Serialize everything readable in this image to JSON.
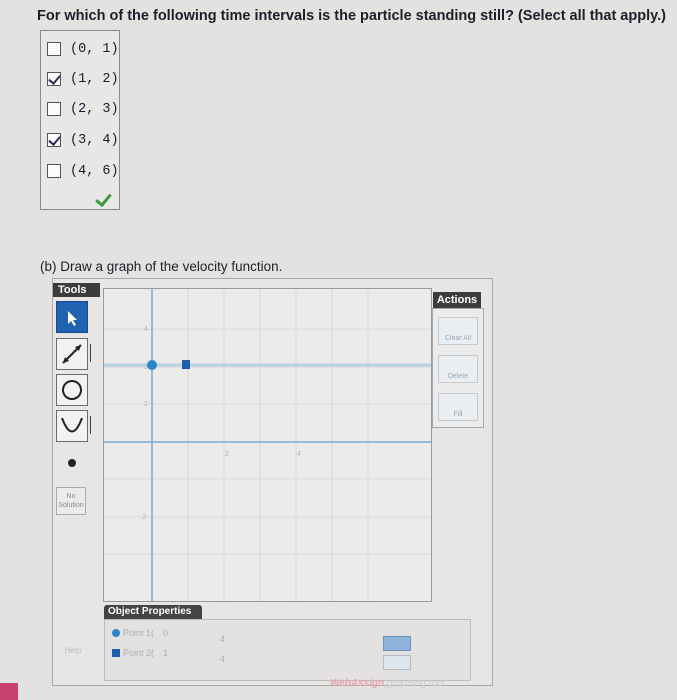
{
  "question": {
    "text": "For which of the following time intervals is the particle standing still? (Select all that apply.)",
    "choices": [
      {
        "label": "(0, 1)",
        "checked": false
      },
      {
        "label": "(1, 2)",
        "checked": true
      },
      {
        "label": "(2, 3)",
        "checked": false
      },
      {
        "label": "(3, 4)",
        "checked": true
      },
      {
        "label": "(4, 6)",
        "checked": false
      }
    ]
  },
  "part_b": {
    "text": "(b) Draw a graph of the velocity function."
  },
  "tools": {
    "header": "Tools",
    "no_solution": "No Solution"
  },
  "actions": {
    "header": "Actions",
    "clear_all": "Clear All",
    "delete": "Delete",
    "fill": "Fill"
  },
  "graph": {
    "x_ticks": [
      "2",
      "4"
    ],
    "y_ticks": [
      "4",
      "3",
      "2",
      "-2"
    ],
    "segment": {
      "points": [
        [
          1,
          4
        ],
        [
          2,
          4
        ]
      ]
    }
  },
  "object_properties": {
    "header": "Object Properties",
    "point1": {
      "label": "Point 1(",
      "x": "0",
      "y": "4"
    },
    "point2": {
      "label": "Point 2(",
      "x": "1",
      "y": "4"
    }
  },
  "side_button": "Help",
  "brand": {
    "part1": "WebAssign",
    "part2": " graphing tool"
  },
  "colors": {
    "accent": "#1f63b2",
    "check": "#3b9a3b",
    "point": "#2a86c7"
  }
}
